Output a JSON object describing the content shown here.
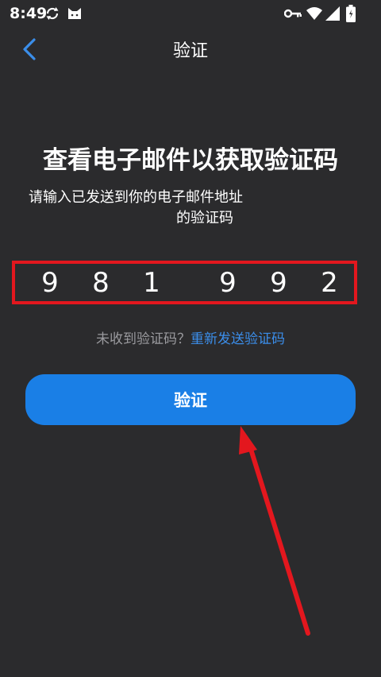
{
  "status_bar": {
    "time": "8:49",
    "icons": [
      "sync-icon",
      "cat-icon",
      "key-icon",
      "wifi-icon",
      "signal-icon",
      "battery-icon"
    ]
  },
  "header": {
    "title": "验证",
    "back_icon": "chevron-left-icon"
  },
  "main": {
    "heading": "查看电子邮件以获取验证码",
    "subtext_line1": "请输入已发送到你的电子邮件地址",
    "subtext_line2": "的验证码",
    "code_digits": [
      "9",
      "8",
      "1",
      "9",
      "9",
      "2"
    ],
    "resend_prompt": "未收到验证码？",
    "resend_link": "重新发送验证码",
    "verify_button": "验证"
  },
  "colors": {
    "background": "#2b2b2d",
    "accent": "#1a7fe6",
    "link": "#3b8eea",
    "annotation": "#e3171e"
  }
}
